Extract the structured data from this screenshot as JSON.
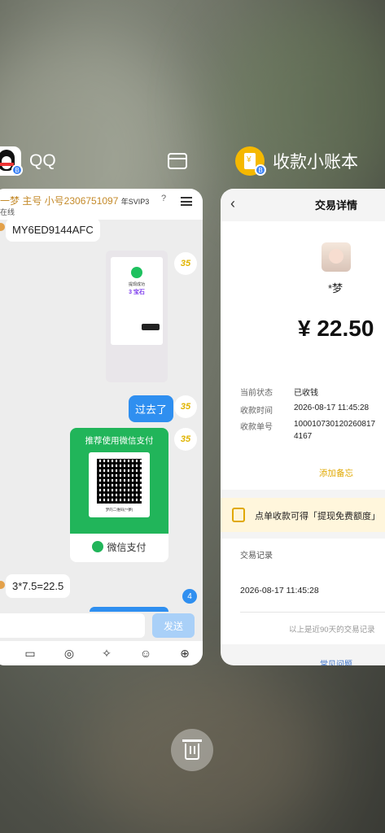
{
  "apps": [
    {
      "name": "QQ"
    },
    {
      "name": "收款小账本"
    }
  ],
  "qq": {
    "header_title": "一梦 主号  小号2306751097",
    "svip": "年SVIP3",
    "status": "在线",
    "help": "?",
    "messages": {
      "code": "MY6ED9144AFC",
      "image_success": "提现成功",
      "image_amount": "3 宝石",
      "sent_text": "过去了",
      "wechat_card_title": "推荐使用微信支付",
      "wechat_qr_caption": "梦的二维码(**夢)",
      "wechat_pay": "微信支付",
      "calc": "3*7.5=22.5"
    },
    "avatar_label": "35",
    "unread_count": "4",
    "send_button": "发送"
  },
  "ledger": {
    "title": "交易详情",
    "payer": "*梦",
    "amount": "¥ 22.50",
    "fields": [
      {
        "label": "当前状态",
        "value": "已收钱"
      },
      {
        "label": "收款时间",
        "value": "2026-08-17 11:45:28"
      },
      {
        "label": "收款单号",
        "value": "10001073012026081704167"
      }
    ],
    "order_line1": "100010730120260817",
    "order_line2": "4167",
    "add_note": "添加备忘",
    "promo": "点单收款可得「提现免费额度」",
    "records_header": "交易记录",
    "record_date": "2026-08-17 11:45:28",
    "records_footer": "以上是近90天的交易记录",
    "faq": "常见问题"
  }
}
